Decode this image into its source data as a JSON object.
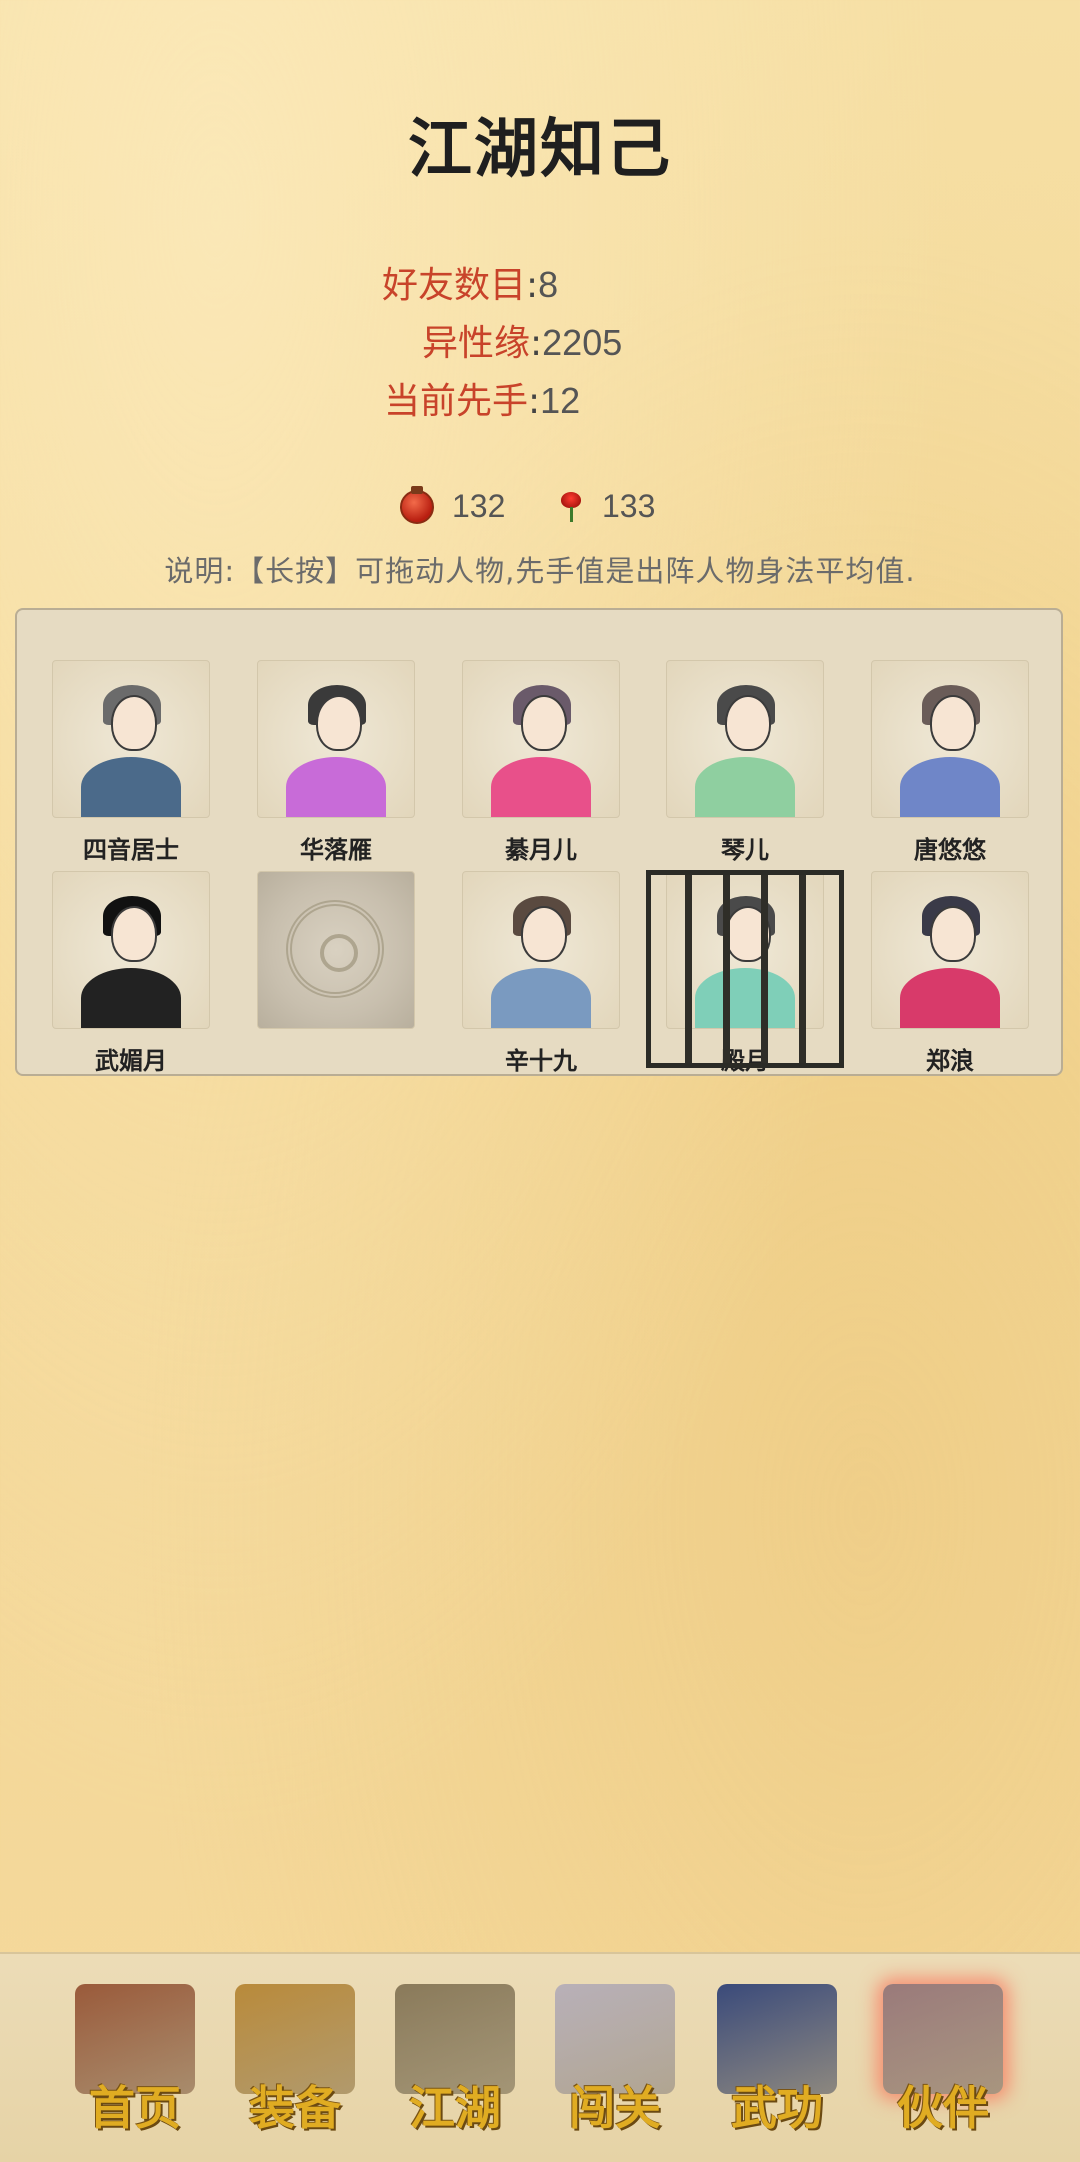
{
  "title": "江湖知己",
  "stats": {
    "friends_label": "好友数目",
    "friends_value": "8",
    "affinity_label": "异性缘",
    "affinity_value": "2205",
    "initiative_label": "当前先手",
    "initiative_value": "12",
    "separator": ":"
  },
  "resources": {
    "wine": {
      "icon": "wine-jar-icon",
      "value": "132"
    },
    "rose": {
      "icon": "rose-icon",
      "value": "133"
    }
  },
  "description": "说明:【长按】可拖动人物,先手值是出阵人物身法平均值.",
  "companions": [
    {
      "name": "四音居士",
      "hair": "#6b6b6b",
      "robe": "#4b6a8a",
      "locked": false,
      "caged": false
    },
    {
      "name": "华落雁",
      "hair": "#3a3a3a",
      "robe": "#c86bd8",
      "locked": false,
      "caged": false
    },
    {
      "name": "綦月儿",
      "hair": "#6a5a6a",
      "robe": "#e8508a",
      "locked": false,
      "caged": false
    },
    {
      "name": "琴儿",
      "hair": "#4a4a4a",
      "robe": "#8fcfa0",
      "locked": false,
      "caged": false
    },
    {
      "name": "唐悠悠",
      "hair": "#6a5c58",
      "robe": "#6f86c8",
      "locked": false,
      "caged": false
    },
    {
      "name": "武媚月",
      "hair": "#111111",
      "robe": "#222222",
      "locked": false,
      "caged": false
    },
    {
      "name": "",
      "hair": "",
      "robe": "",
      "locked": true,
      "caged": false
    },
    {
      "name": "辛十九",
      "hair": "#5a4a40",
      "robe": "#7a9ac0",
      "locked": false,
      "caged": false
    },
    {
      "name": "殿月",
      "hair": "#4a4a4a",
      "robe": "#7fcfb8",
      "locked": false,
      "caged": true
    },
    {
      "name": "郑浪",
      "hair": "#3a3a48",
      "robe": "#d83a6a",
      "locked": false,
      "caged": false
    }
  ],
  "nav": [
    {
      "label": "首页",
      "icon": "house-icon",
      "color": "#9a5a3a",
      "active": false
    },
    {
      "label": "装备",
      "icon": "armor-icon",
      "color": "#b98a3a",
      "active": false
    },
    {
      "label": "江湖",
      "icon": "scroll-map-icon",
      "color": "#8a7a5a",
      "active": false
    },
    {
      "label": "闯关",
      "icon": "crossed-swords-icon",
      "color": "#b8b0b8",
      "active": false
    },
    {
      "label": "武功",
      "icon": "book-icon",
      "color": "#3a4a7a",
      "active": false
    },
    {
      "label": "伙伴",
      "icon": "companions-icon",
      "color": "#9a7a7a",
      "active": true
    }
  ]
}
